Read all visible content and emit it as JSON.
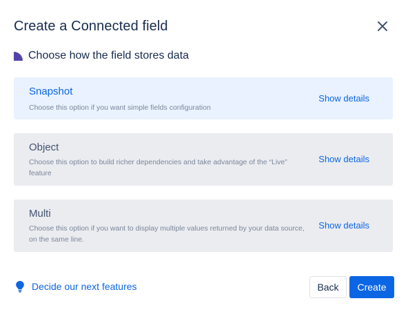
{
  "dialog": {
    "title": "Create a Connected field"
  },
  "section": {
    "heading": "Choose how the field stores data",
    "marker_color": "#5243aa"
  },
  "options": [
    {
      "title": "Snapshot",
      "description": "Choose this option if you want simple fields configuration",
      "action": "Show details",
      "selected": true
    },
    {
      "title": "Object",
      "description": "Choose this option to build richer dependencies and take advantage of the “Live” feature",
      "action": "Show details",
      "selected": false
    },
    {
      "title": "Multi",
      "description": "Choose this option if you want to display multiple values returned by your data source, on the same line.",
      "action": "Show details",
      "selected": false
    }
  ],
  "footer": {
    "feedback_link": "Decide our next features",
    "feedback_icon": "lightbulb-icon",
    "back_label": "Back",
    "create_label": "Create"
  },
  "colors": {
    "primary": "#0c66e4",
    "selected_bg": "#e9f2fe",
    "option_bg": "#ebecf0"
  }
}
